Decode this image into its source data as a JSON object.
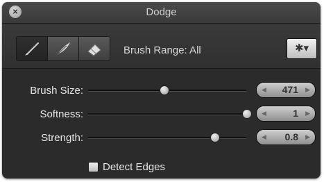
{
  "window": {
    "title": "Dodge",
    "close_icon": "close-icon"
  },
  "toolbar": {
    "tools": [
      {
        "name": "brush-icon",
        "selected": true
      },
      {
        "name": "feather-icon",
        "selected": false
      },
      {
        "name": "eraser-icon",
        "selected": false
      }
    ],
    "brush_range_label": "Brush Range: All",
    "gear_label": "✱▾"
  },
  "controls": [
    {
      "label": "Brush Size:",
      "value": "471",
      "slider_fraction": 0.48
    },
    {
      "label": "Softness:",
      "value": "1",
      "slider_fraction": 1.0
    },
    {
      "label": "Strength:",
      "value": "0.8",
      "slider_fraction": 0.8
    }
  ],
  "detect_edges": {
    "label": "Detect Edges",
    "checked": false
  }
}
